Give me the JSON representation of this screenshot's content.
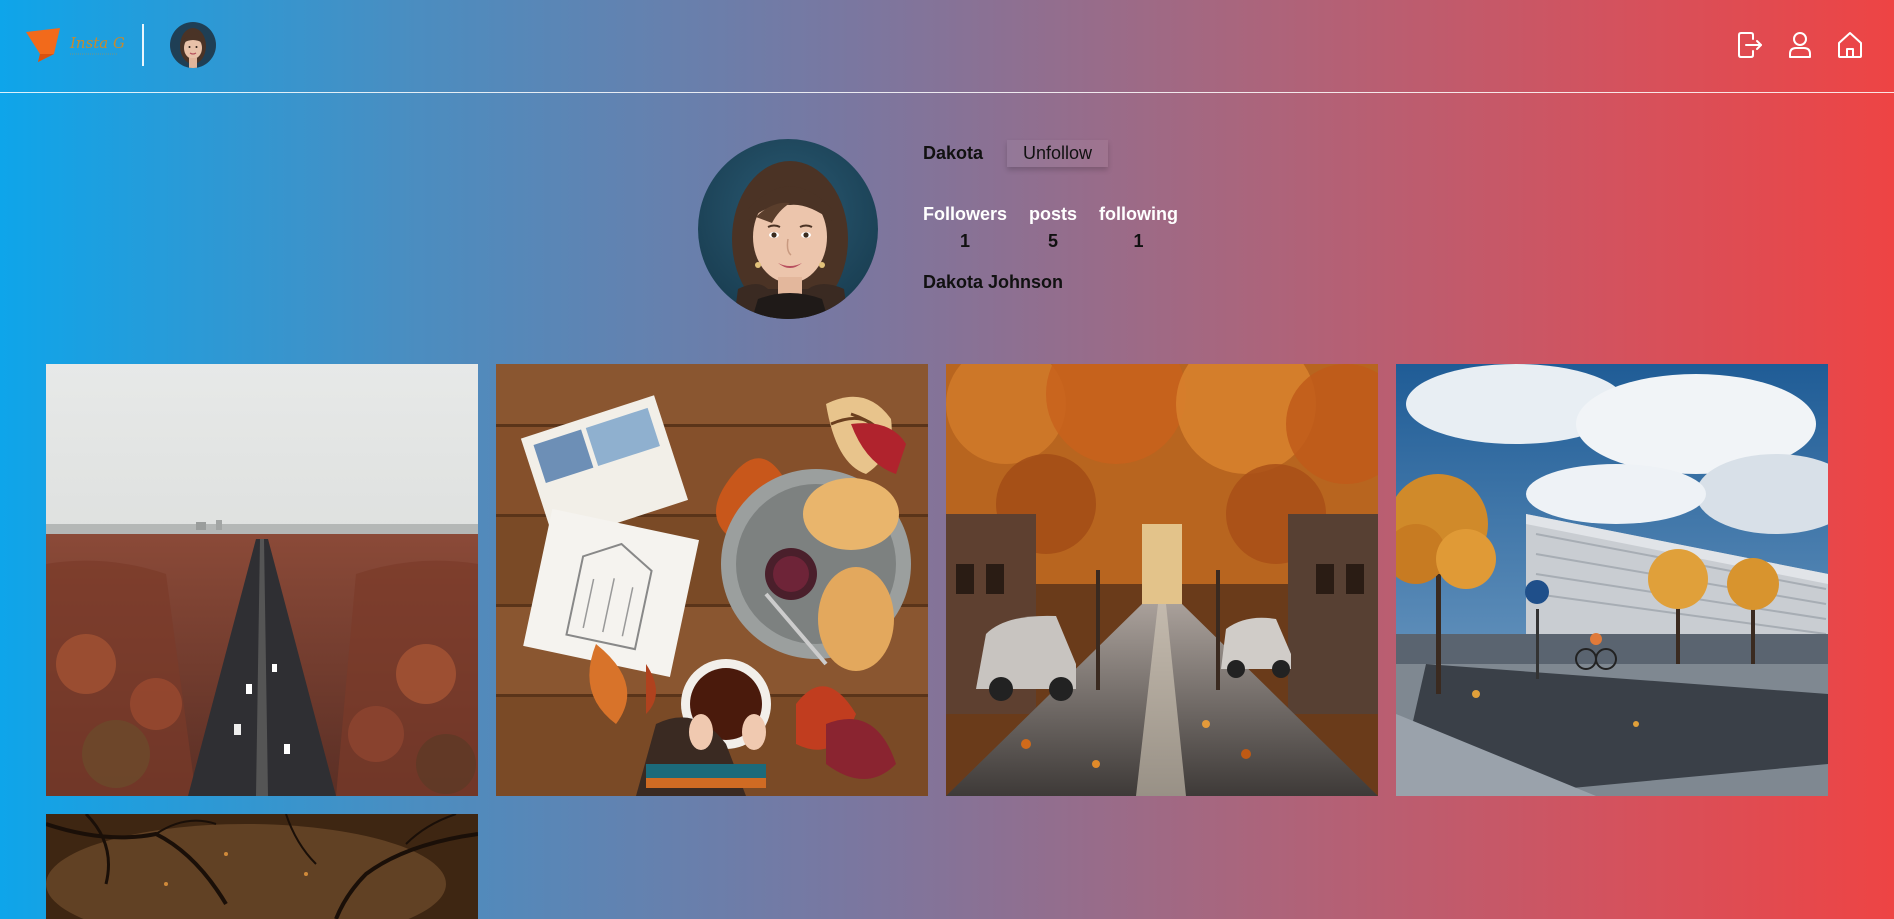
{
  "header": {
    "logo_text": "Insta G",
    "icons": [
      "logout-icon",
      "user-icon",
      "home-icon"
    ]
  },
  "profile": {
    "username": "Dakota",
    "follow_button_label": "Unfollow",
    "stats": [
      {
        "label": "Followers",
        "value": "1"
      },
      {
        "label": "posts",
        "value": "5"
      },
      {
        "label": "following",
        "value": "1"
      }
    ],
    "full_name": "Dakota Johnson"
  },
  "posts": [
    {
      "subject": "aerial road through autumn forest"
    },
    {
      "subject": "autumn leaves, croissants and tea on wooden table"
    },
    {
      "subject": "autumn tree-lined street with cars"
    },
    {
      "subject": "autumn trees in front of modern building with cyclist"
    },
    {
      "subject": "dark autumn branches"
    }
  ],
  "colors": {
    "gradient_left": "#0ea5ea",
    "gradient_right": "#ee4444"
  }
}
